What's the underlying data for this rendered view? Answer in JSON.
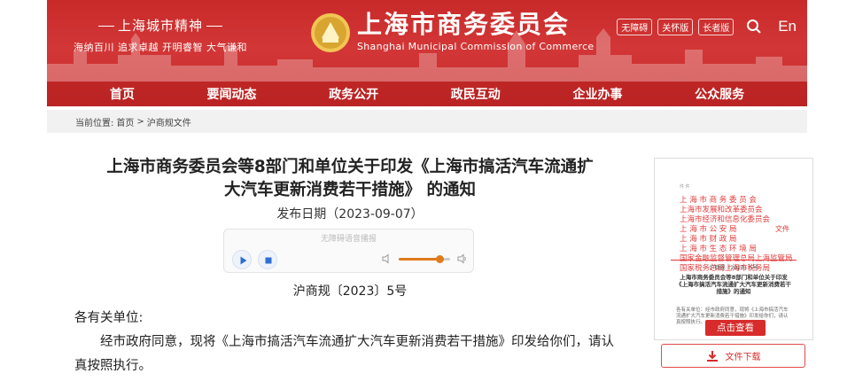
{
  "header": {
    "spirit_title": "上海城市精神",
    "spirit_sub": "海纳百川  追求卓越  开明睿智  大气谦和",
    "brand_cn": "上海市商务委员会",
    "brand_en": "Shanghai Municipal Commission of Commerce",
    "tools": [
      "无障碍",
      "关怀版",
      "长者版"
    ],
    "lang": "En",
    "colors": {
      "banner": "#c82a2a",
      "accent": "#d82b2b"
    }
  },
  "nav": [
    "首页",
    "要闻动态",
    "政务公开",
    "政民互动",
    "企业办事",
    "公众服务"
  ],
  "breadcrumb": {
    "prefix": "当前位置:",
    "home": "首页",
    "sep": ">",
    "current": "沪商规文件"
  },
  "article": {
    "title_line1": "上海市商务委员会等8部门和单位关于印发《上海市搞活汽车流通扩",
    "title_line2": "大汽车更新消费若干措施》 的通知",
    "pubdate": "发布日期（2023-09-07）",
    "player": {
      "label": "无障碍语音播报",
      "volume": 0.8
    },
    "docno": "沪商规〔2023〕5号",
    "salutation": "各有关单位:",
    "para": "经市政府同意，现将《上海市搞活汽车流通扩大汽车更新消费若干措施》印发给你们，请认真按照执行。"
  },
  "sidebar": {
    "thumb_label": "件 件",
    "thumb_lines": [
      "上 海 市 商 务 委 员 会",
      "上海市发展和改革委员会",
      "上海市经济和信息化委员会",
      "上  海  市  公  安  局",
      "上  海  市  财  政  局",
      "上 海 市 生 态 环 境 局",
      "国家金融监督管理总局上海监管局",
      "国家税务总局上海市税务局"
    ],
    "thumb_wen": "文件",
    "thumb_no": "沪商规〔2023〕5号",
    "thumb_heading": "上海市商务委员会等8部门和单位关于印发《上海市搞活汽车流通扩大汽车更新消费若干措施》的通知",
    "thumb_body": "各有关单位：经市政府同意，现将《上海市搞活汽车流通扩大汽车更新消费若干措施》印发给你们，请认真按照执行。",
    "view_label": "点击查看",
    "download_label": "文件下载"
  }
}
